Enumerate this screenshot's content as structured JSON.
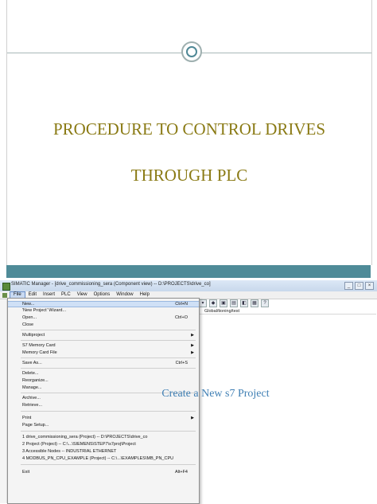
{
  "slide": {
    "title_line1": "PROCEDURE TO CONTROL DRIVES",
    "title_line2": "THROUGH PLC",
    "caption": "Create a New s7 Project"
  },
  "window": {
    "title": "SIMATIC Manager - [drive_commissioning_sera (Component view) -- D:\\PROJECTS\\drive_co]",
    "workspace_header": "Global/tioning/test"
  },
  "menubar": {
    "items": [
      "File",
      "Edit",
      "Insert",
      "PLC",
      "View",
      "Options",
      "Window",
      "Help"
    ]
  },
  "file_menu": {
    "items": [
      {
        "label": "New...",
        "shortcut": "Ctrl+N"
      },
      {
        "label": "'New Project' Wizard...",
        "shortcut": ""
      },
      {
        "label": "Open...",
        "shortcut": "Ctrl+O"
      },
      {
        "label": "Close",
        "shortcut": ""
      },
      {
        "label": "Multiproject",
        "shortcut": ""
      },
      {
        "label": "S7 Memory Card",
        "shortcut": ""
      },
      {
        "label": "Memory Card File",
        "shortcut": ""
      },
      {
        "label": "Save As...",
        "shortcut": "Ctrl+S"
      },
      {
        "label": "Delete...",
        "shortcut": ""
      },
      {
        "label": "Reorganize...",
        "shortcut": ""
      },
      {
        "label": "Manage...",
        "shortcut": ""
      },
      {
        "label": "Archive...",
        "shortcut": ""
      },
      {
        "label": "Retrieve...",
        "shortcut": ""
      },
      {
        "label": "Print",
        "shortcut": ""
      },
      {
        "label": "Page Setup...",
        "shortcut": ""
      },
      {
        "label": "1 drive_commissioning_sera (Project) -- D:\\PROJECTS\\drive_co",
        "shortcut": ""
      },
      {
        "label": "2 Project (Project) -- C:\\...\\SIEMENS\\STEP7\\s7proj\\Project",
        "shortcut": ""
      },
      {
        "label": "3 Accessible Nodes -- INDUSTRIAL ETHERNET",
        "shortcut": ""
      },
      {
        "label": "4 MODBUS_PN_CPU_EXAMPLE (Project) -- C:\\...\\EXAMPLES\\MB_PN_CPU",
        "shortcut": ""
      },
      {
        "label": "Exit",
        "shortcut": "Alt+F4"
      }
    ]
  },
  "colors": {
    "title_gold": "#8a7a14",
    "teal_band": "#4f8b98",
    "caption_blue": "#3f7fb4"
  }
}
